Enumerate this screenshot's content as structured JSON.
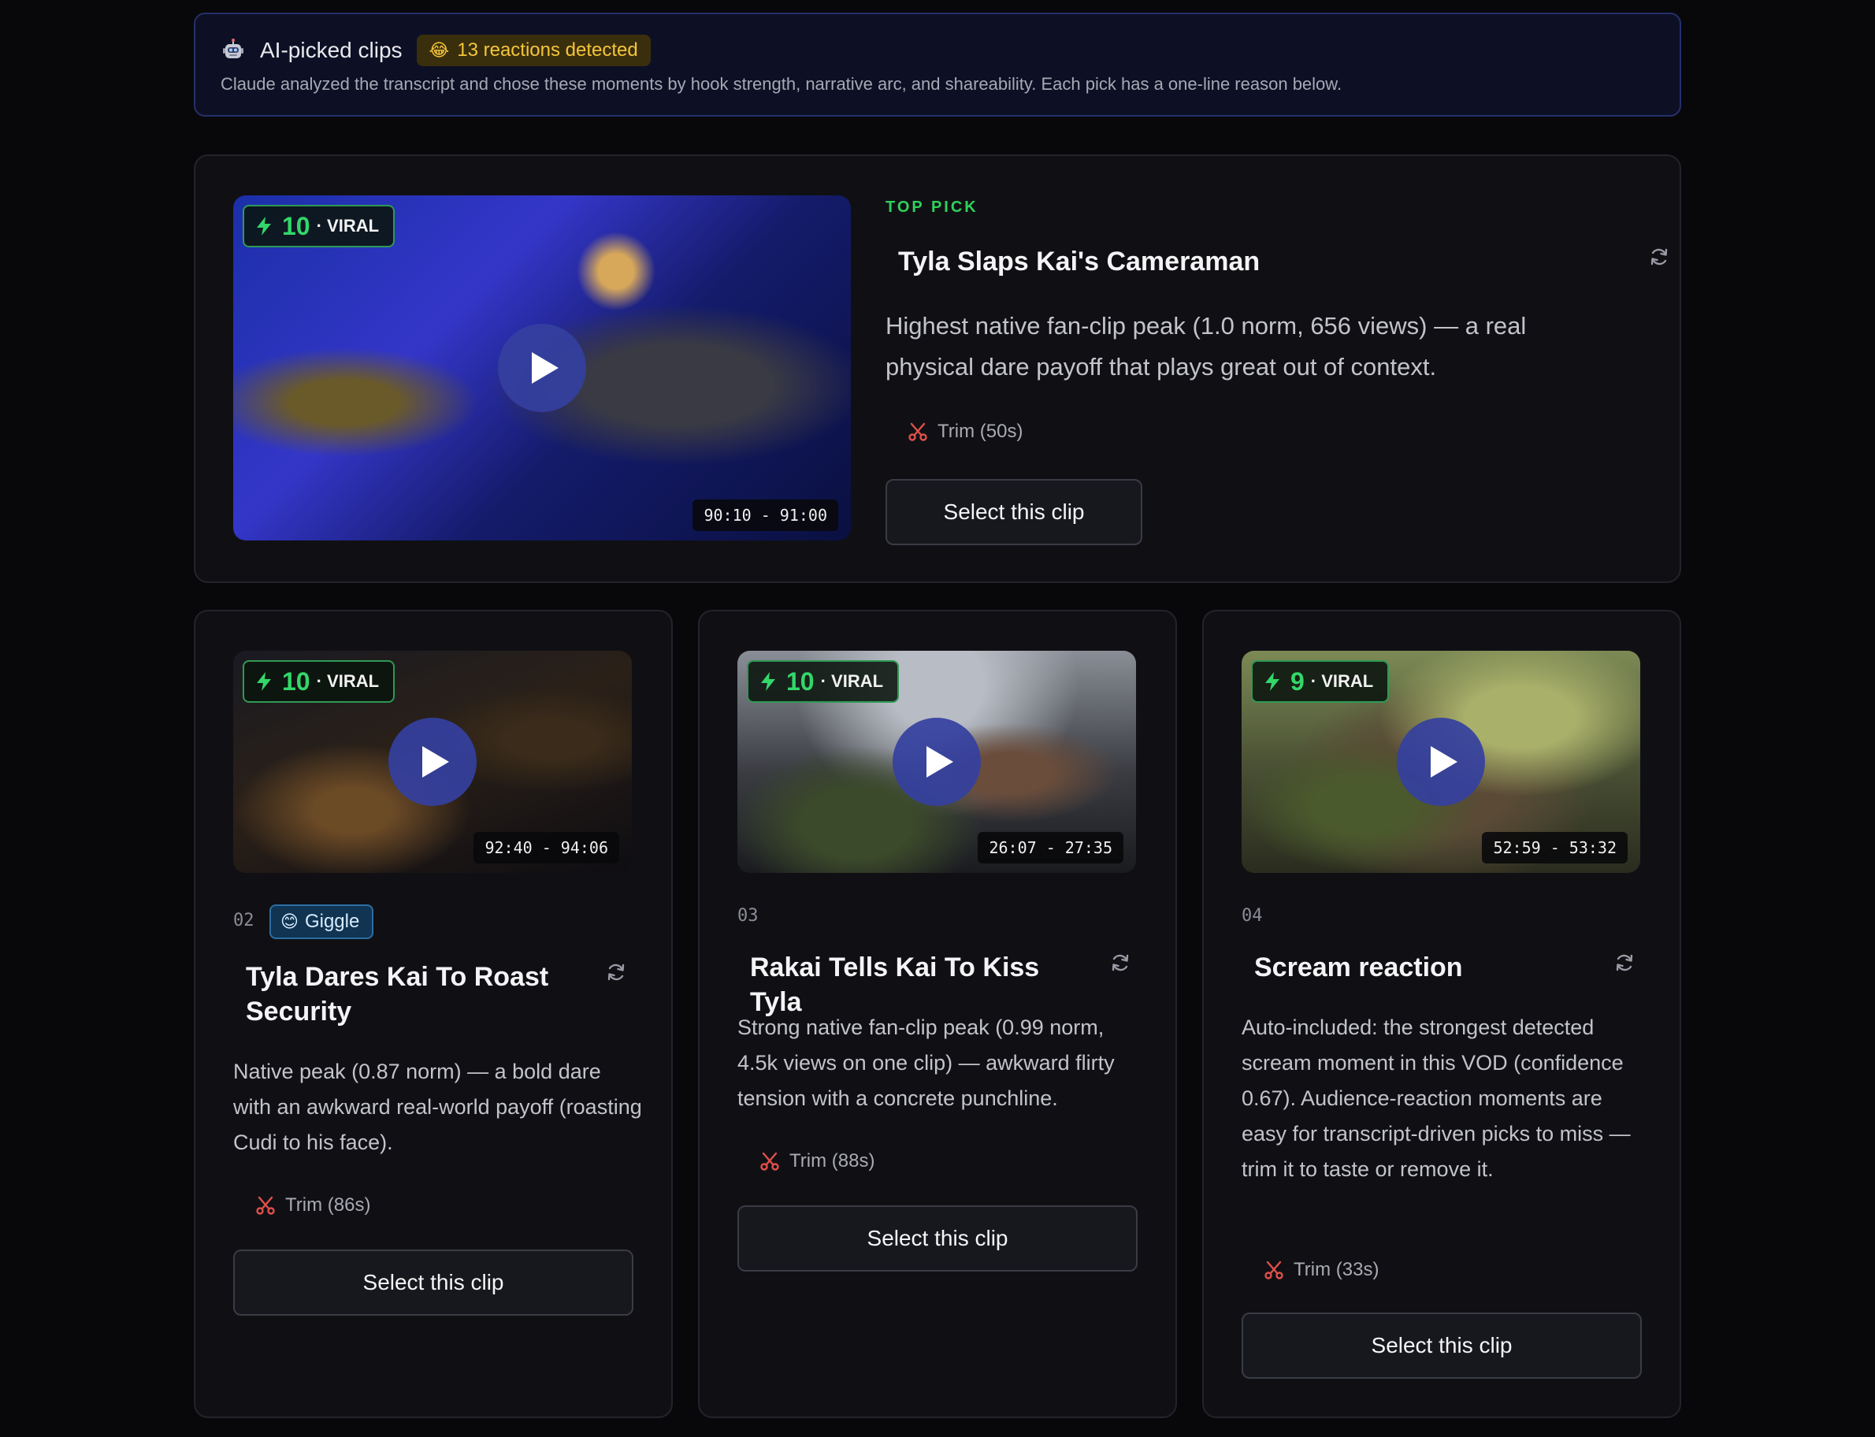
{
  "banner": {
    "title": "AI-picked clips",
    "reactions_badge": "13 reactions detected",
    "reactions_emoji": "😂",
    "description": "Claude analyzed the transcript and chose these moments by hook strength, narrative arc, and shareability. Each pick has a one-line reason below."
  },
  "top_clip": {
    "label": "TOP PICK",
    "score": "10",
    "score_label": "· VIRAL",
    "time_range": "90:10 - 91:00",
    "title": "Tyla Slaps Kai's Cameraman",
    "reason": "Highest native fan-clip peak (1.0 norm, 656 views) — a real physical dare payoff that plays great out of context.",
    "trim": "Trim (50s)",
    "select_label": "Select this clip"
  },
  "clips": [
    {
      "number": "02",
      "tag": "Giggle",
      "tag_emoji": "😊",
      "score": "10",
      "score_label": "· VIRAL",
      "time_range": "92:40 - 94:06",
      "title": "Tyla Dares Kai To Roast Security",
      "reason": "Native peak (0.87 norm) — a bold dare with an awkward real-world payoff (roasting Cudi to his face).",
      "trim": "Trim (86s)",
      "select_label": "Select this clip"
    },
    {
      "number": "03",
      "score": "10",
      "score_label": "· VIRAL",
      "time_range": "26:07 - 27:35",
      "title": "Rakai Tells Kai To Kiss Tyla",
      "reason": "Strong native fan-clip peak (0.99 norm, 4.5k views on one clip) — awkward flirty tension with a concrete punchline.",
      "trim": "Trim (88s)",
      "select_label": "Select this clip"
    },
    {
      "number": "04",
      "score": "9",
      "score_label": "· VIRAL",
      "time_range": "52:59 - 53:32",
      "title": "Scream reaction",
      "reason": "Auto-included: the strongest detected scream moment in this VOD (confidence 0.67). Audience-reaction moments are easy for transcript-driven picks to miss — trim it to taste or remove it.",
      "trim": "Trim (33s)",
      "select_label": "Select this clip"
    }
  ],
  "colors": {
    "viral_green": "#34d66a",
    "top_pick_green": "#2fd15c",
    "reaction_yellow": "#f5c53b",
    "play_blue": "#3440a0",
    "trim_red": "#e0504a"
  },
  "icons": [
    "robot-icon",
    "bolt-icon",
    "play-icon",
    "regenerate-icon",
    "scissors-icon"
  ]
}
